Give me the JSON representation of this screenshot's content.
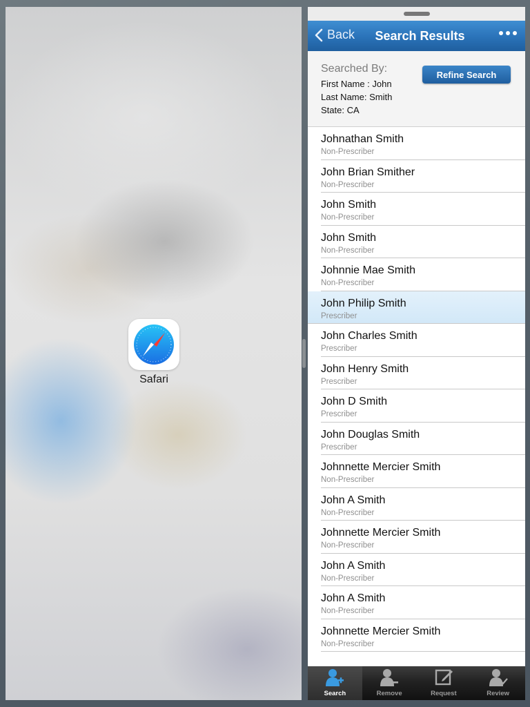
{
  "left_pane": {
    "app_icon": "safari-icon",
    "app_label": "Safari"
  },
  "nav": {
    "back_label": "Back",
    "title": "Search Results",
    "more_icon": "more-dots-icon"
  },
  "criteria": {
    "heading": "Searched By:",
    "first_name": "First Name : John",
    "last_name": "Last Name: Smith",
    "state": "State: CA",
    "refine_label": "Refine Search"
  },
  "results": [
    {
      "name": "Johnathan Smith",
      "type": "Non-Prescriber"
    },
    {
      "name": "John Brian Smither",
      "type": "Non-Prescriber"
    },
    {
      "name": "John Smith",
      "type": "Non-Prescriber"
    },
    {
      "name": "John Smith",
      "type": "Non-Prescriber"
    },
    {
      "name": "Johnnie Mae Smith",
      "type": "Non-Prescriber"
    },
    {
      "name": "John Philip Smith",
      "type": "Prescriber"
    },
    {
      "name": "John Charles Smith",
      "type": "Prescriber"
    },
    {
      "name": "John Henry Smith",
      "type": "Prescriber"
    },
    {
      "name": "John D Smith",
      "type": "Prescriber"
    },
    {
      "name": "John Douglas Smith",
      "type": "Prescriber"
    },
    {
      "name": "Johnnette Mercier Smith",
      "type": "Non-Prescriber"
    },
    {
      "name": "John A Smith",
      "type": "Non-Prescriber"
    },
    {
      "name": "Johnnette Mercier Smith",
      "type": "Non-Prescriber"
    },
    {
      "name": "John A Smith",
      "type": "Non-Prescriber"
    },
    {
      "name": "John A Smith",
      "type": "Non-Prescriber"
    },
    {
      "name": "Johnnette Mercier Smith",
      "type": "Non-Prescriber"
    }
  ],
  "highlighted_index": 5,
  "tabs": [
    {
      "label": "Search",
      "icon": "person-add-icon",
      "active": true
    },
    {
      "label": "Remove",
      "icon": "person-remove-icon",
      "active": false
    },
    {
      "label": "Request",
      "icon": "edit-icon",
      "active": false
    },
    {
      "label": "Review",
      "icon": "person-check-icon",
      "active": false
    }
  ],
  "colors": {
    "nav_blue": "#2a72b8",
    "highlight_row": "#d9ecf9",
    "active_tab_icon": "#3a9ae0"
  }
}
